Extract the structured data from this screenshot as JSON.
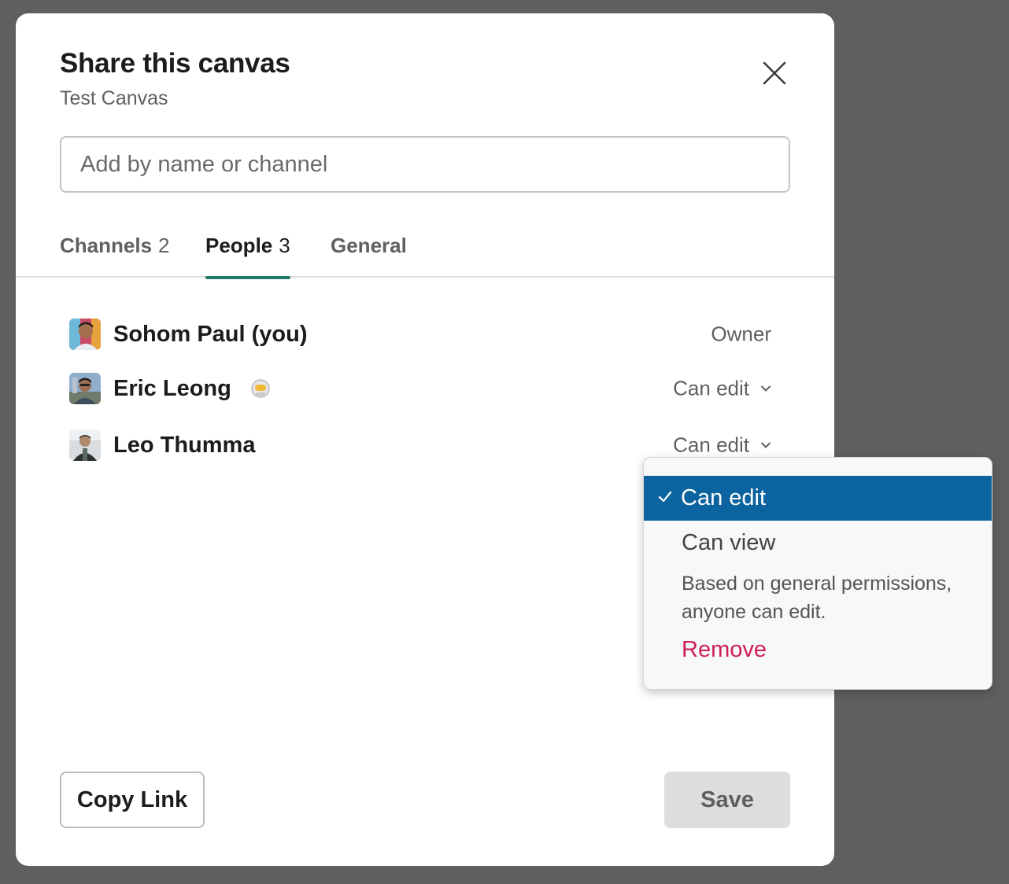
{
  "modal": {
    "title": "Share this canvas",
    "subtitle": "Test Canvas",
    "close_icon": "close-icon"
  },
  "search": {
    "placeholder": "Add by name or channel",
    "value": ""
  },
  "tabs": [
    {
      "label": "Channels",
      "count": "2",
      "active": false
    },
    {
      "label": "People",
      "count": "3",
      "active": true
    },
    {
      "label": "General",
      "count": "",
      "active": false
    }
  ],
  "people": [
    {
      "name": "Sohom Paul (you)",
      "role": "Owner",
      "has_dropdown": false
    },
    {
      "name": "Eric Leong",
      "role": "Can edit",
      "has_dropdown": true,
      "status_icon": "astronaut-emoji-icon"
    },
    {
      "name": "Leo Thumma",
      "role": "Can edit",
      "has_dropdown": true
    }
  ],
  "dropdown": {
    "selected": "Can edit",
    "option_view": "Can view",
    "note": "Based on general permissions, anyone can edit.",
    "remove": "Remove"
  },
  "footer": {
    "copy_link": "Copy Link",
    "save": "Save"
  },
  "colors": {
    "accent": "#1f7a66",
    "selected_bg": "#0b63a0",
    "remove": "#cc1f5a",
    "overlay": "#5f5f5f"
  }
}
